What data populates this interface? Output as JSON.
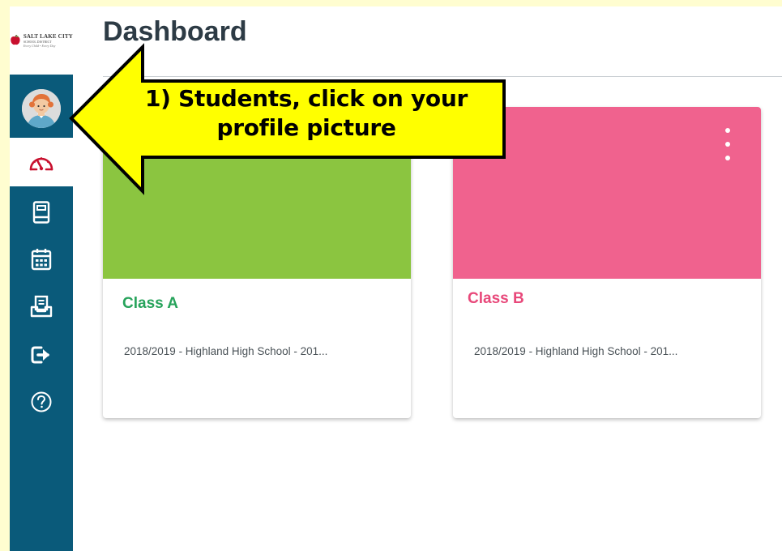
{
  "colors": {
    "page_background": "#fffdd0",
    "sidebar": "#0a5a7a",
    "nav_active_icon": "#c8102e",
    "card_a_hero": "#8bc540",
    "card_a_title": "#27a35b",
    "card_b_hero": "#f0628e",
    "card_b_title": "#e8487a",
    "callout_fill": "#ffff00",
    "callout_stroke": "#000000"
  },
  "sidebar": {
    "logo": {
      "icon": "apple-logo-icon",
      "line1": "SALT LAKE CITY",
      "line2": "SCHOOL DISTRICT",
      "line3": "Every Child • Every Day"
    },
    "avatar": {
      "icon": "student-avatar-icon"
    },
    "items": [
      {
        "id": "dashboard",
        "icon": "dashboard-gauge-icon",
        "active": true
      },
      {
        "id": "courses",
        "icon": "book-icon"
      },
      {
        "id": "calendar",
        "icon": "calendar-icon"
      },
      {
        "id": "inbox",
        "icon": "inbox-tray-icon"
      },
      {
        "id": "commons",
        "icon": "arrow-right-exit-icon"
      },
      {
        "id": "help",
        "icon": "help-circle-icon"
      }
    ]
  },
  "main": {
    "title": "Dashboard",
    "cards": [
      {
        "title": "Class A",
        "subtitle": "2018/2019 - Highland High School - 201..."
      },
      {
        "title": "Class B",
        "subtitle": "2018/2019 - Highland High School - 201...",
        "menu_icon": "kebab-menu-icon"
      }
    ]
  },
  "callout": {
    "line1": "1) Students, click on your",
    "line2": "profile picture"
  }
}
